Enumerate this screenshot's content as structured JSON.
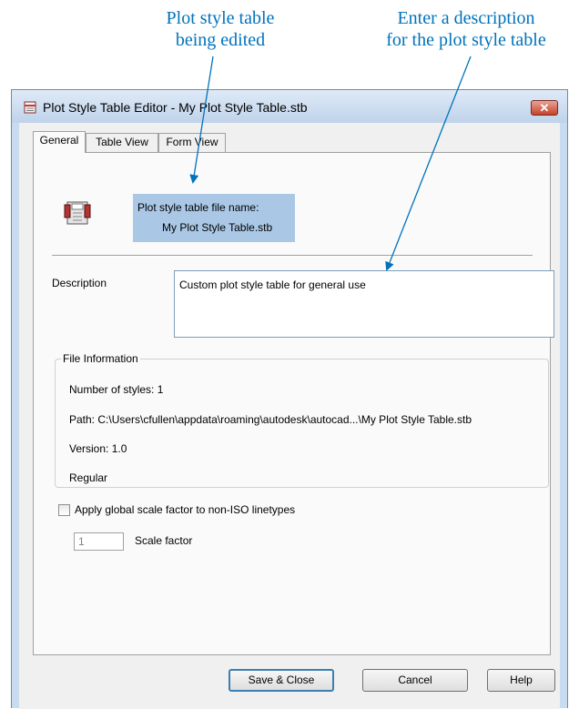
{
  "callouts": {
    "edited_line1": "Plot style table",
    "edited_line2": "being edited",
    "description_line1": "Enter a description",
    "description_line2": "for the plot style table"
  },
  "window": {
    "title": "Plot Style Table Editor - My Plot Style Table.stb",
    "close_glyph": "✕",
    "icon": "plot-style-editor-icon"
  },
  "tabs": [
    {
      "label": "General",
      "selected": true
    },
    {
      "label": "Table View",
      "selected": false
    },
    {
      "label": "Form View",
      "selected": false
    }
  ],
  "general": {
    "file_name_label": "Plot style table file name:",
    "file_name": "My Plot Style Table.stb",
    "file_icon": "plot-style-file-icon",
    "description_label": "Description",
    "description_value": "Custom plot style table for general use",
    "file_info": {
      "title": "File Information",
      "styles": "Number of styles: 1",
      "path": "Path: C:\\Users\\cfullen\\appdata\\roaming\\autodesk\\autocad...\\My Plot Style Table.stb",
      "version": "Version: 1.0",
      "type": "Regular"
    },
    "scale_checkbox_label": "Apply global scale factor to non-ISO linetypes",
    "scale_checked": false,
    "scale_value": "1",
    "scale_label": "Scale factor"
  },
  "buttons": {
    "save": "Save & Close",
    "cancel": "Cancel",
    "help": "Help"
  },
  "colors": {
    "callout": "#0072bc",
    "highlight": "#aac8e6"
  }
}
